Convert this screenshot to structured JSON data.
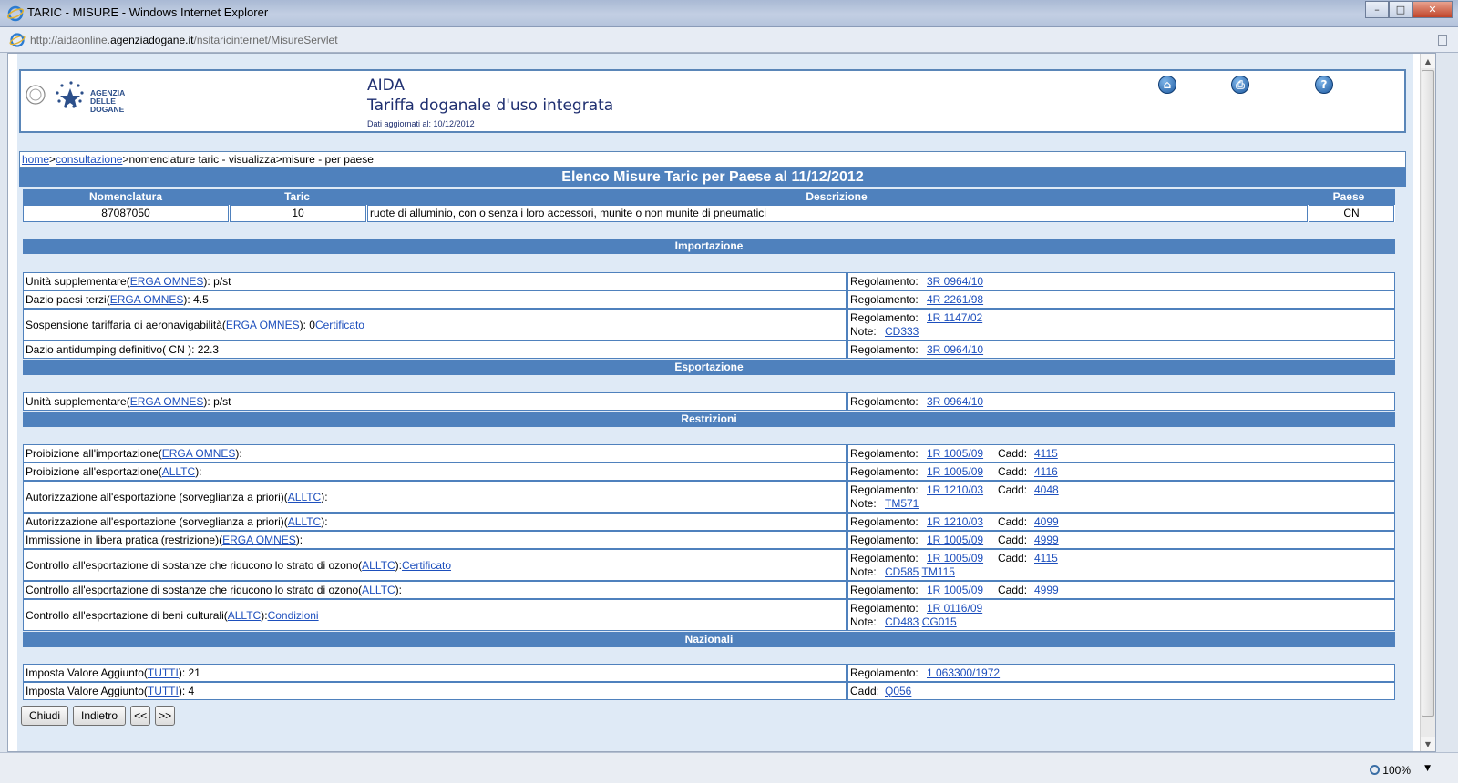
{
  "window": {
    "title": "TARIC - MISURE - Windows Internet Explorer"
  },
  "address": {
    "url_prefix": "http://aidaonline.",
    "url_domain": "agenziadogane.it",
    "url_path": "/nsitaricinternet/MisureServlet"
  },
  "header": {
    "logo_line1": "AGENZIA",
    "logo_line2": "DELLE",
    "logo_line3": "DOGANE",
    "app_name": "AIDA",
    "app_subtitle": "Tariffa doganale d'uso integrata",
    "updated": "Dati aggiornati al: 10/12/2012",
    "icons": [
      "home-icon",
      "print-icon",
      "help-icon"
    ]
  },
  "breadcrumb": {
    "home": "home",
    "sep": ">",
    "consult": "consultazione",
    "rest": ">nomenclature taric - visualizza>misure - per paese"
  },
  "main_title": "Elenco Misure Taric per Paese al 11/12/2012",
  "columns": {
    "nomenclatura": "Nomenclatura",
    "taric": "Taric",
    "descrizione": "Descrizione",
    "paese": "Paese"
  },
  "item": {
    "nomenclatura": "87087050",
    "taric": "10",
    "descrizione": "ruote di alluminio, con o senza i loro accessori, munite o non munite di pneumatici",
    "paese": "CN"
  },
  "sections": {
    "importazione": "Importazione",
    "esportazione": "Esportazione",
    "restrizioni": "Restrizioni",
    "nazionali": "Nazionali"
  },
  "labels": {
    "regolamento": "Regolamento:",
    "note": "Note:",
    "cadd": "Cadd:"
  },
  "imp": [
    {
      "pre": "Unità supplementare( ",
      "link": "ERGA OMNES",
      "post": " ): p/st",
      "reg": "3R 0964/10"
    },
    {
      "pre": "Dazio paesi terzi( ",
      "link": "ERGA OMNES",
      "post": " ): 4.5",
      "reg": "4R 2261/98"
    },
    {
      "pre": "Sospensione tariffaria di aeronavigabilità( ",
      "link": "ERGA OMNES",
      "post": " ): 0 ",
      "link2": "Certificato",
      "reg": "1R 1147/02",
      "note": "CD333"
    },
    {
      "pre": "Dazio antidumping definitivo( CN ): 22.3",
      "reg": "3R 0964/10"
    }
  ],
  "exp": [
    {
      "pre": "Unità supplementare( ",
      "link": "ERGA OMNES",
      "post": " ): p/st",
      "reg": "3R 0964/10"
    }
  ],
  "restr": [
    {
      "pre": "Proibizione all'importazione( ",
      "link": "ERGA OMNES",
      "post": " ):",
      "reg": "1R 1005/09",
      "cadd": "4115"
    },
    {
      "pre": "Proibizione all'esportazione( ",
      "link": "ALLTC",
      "post": " ):",
      "reg": "1R 1005/09",
      "cadd": "4116"
    },
    {
      "pre": "Autorizzazione all'esportazione (sorveglianza a priori)( ",
      "link": "ALLTC",
      "post": " ):",
      "reg": "1R 1210/03",
      "cadd": "4048",
      "note": "TM571"
    },
    {
      "pre": "Autorizzazione all'esportazione (sorveglianza a priori)( ",
      "link": "ALLTC",
      "post": " ):",
      "reg": "1R 1210/03",
      "cadd": "4099"
    },
    {
      "pre": "Immissione in libera pratica (restrizione)( ",
      "link": "ERGA OMNES",
      "post": " ):",
      "reg": "1R 1005/09",
      "cadd": "4999"
    },
    {
      "pre": "Controllo all'esportazione di sostanze che riducono lo strato di ozono( ",
      "link": "ALLTC",
      "post": " ): ",
      "link2": "Certificato",
      "reg": "1R 1005/09",
      "cadd": "4115",
      "note": "CD585",
      "note2": "TM115"
    },
    {
      "pre": "Controllo all'esportazione di sostanze che riducono lo strato di ozono( ",
      "link": "ALLTC",
      "post": " ):",
      "reg": "1R 1005/09",
      "cadd": "4999"
    },
    {
      "pre": "Controllo all'esportazione di beni culturali( ",
      "link": "ALLTC",
      "post": " ): ",
      "link2": "Condizioni",
      "reg": "1R 0116/09",
      "note": "CD483",
      "note2": "CG015"
    }
  ],
  "naz": [
    {
      "pre": "Imposta Valore Aggiunto( ",
      "link": "TUTTI",
      "post": " ):  21",
      "reg": "1 063300/1972"
    },
    {
      "pre": "Imposta Valore Aggiunto( ",
      "link": "TUTTI",
      "post": " ):  4",
      "cadd_only": "Q056"
    }
  ],
  "buttons": {
    "chiudi": "Chiudi",
    "indietro": "Indietro",
    "prev": "<<",
    "next": ">>"
  },
  "status": {
    "zoom": "100%"
  },
  "colors": {
    "bar": "#4f81bd",
    "link": "#1d4fbd",
    "page_bg": "#dfeaf6"
  }
}
